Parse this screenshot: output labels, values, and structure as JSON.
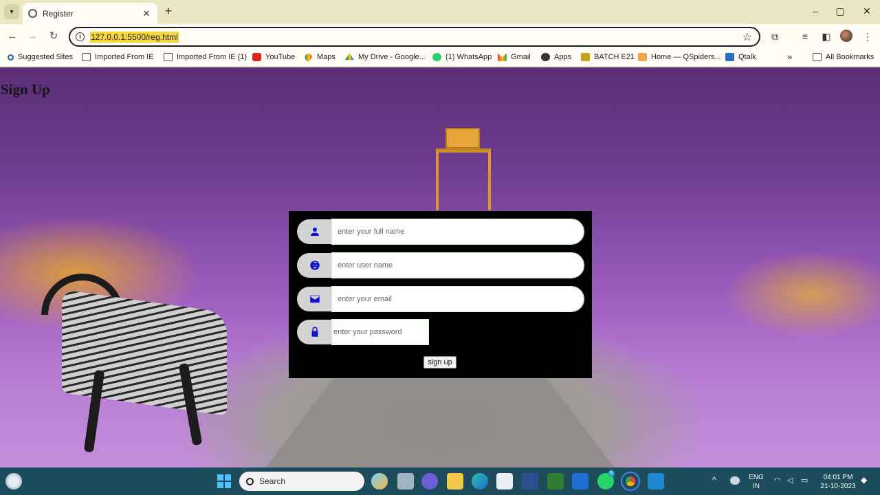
{
  "browser": {
    "tab_title": "Register",
    "url": "127.0.0.1:5500/reg.html",
    "bookmarks": [
      {
        "label": "Suggested Sites",
        "icon": "search-icon"
      },
      {
        "label": "Imported From IE",
        "icon": "folder-icon"
      },
      {
        "label": "Imported From IE (1)",
        "icon": "folder-icon"
      },
      {
        "label": "YouTube",
        "icon": "youtube-icon"
      },
      {
        "label": "Maps",
        "icon": "maps-icon"
      },
      {
        "label": "My Drive - Google...",
        "icon": "drive-icon"
      },
      {
        "label": "(1) WhatsApp",
        "icon": "whatsapp-icon"
      },
      {
        "label": "Gmail",
        "icon": "gmail-icon"
      },
      {
        "label": "Apps",
        "icon": "apps-icon"
      },
      {
        "label": "BATCH E21",
        "icon": "batch-icon"
      },
      {
        "label": "Home — QSpiders...",
        "icon": "qspiders-icon"
      },
      {
        "label": "Qtalk",
        "icon": "qtalk-icon"
      }
    ],
    "all_bookmarks": "All Bookmarks",
    "more_chevron": "»"
  },
  "page": {
    "heading": "Sign Up",
    "form": {
      "fields": [
        {
          "placeholder": "enter your full name",
          "icon": "person-icon"
        },
        {
          "placeholder": "enter user name",
          "icon": "face-icon"
        },
        {
          "placeholder": "enter your email",
          "icon": "mail-icon"
        },
        {
          "placeholder": "enter your password",
          "icon": "lock-icon"
        }
      ],
      "submit_label": "sign up"
    }
  },
  "taskbar": {
    "search_label": "Search",
    "language": "ENG",
    "region": "IN",
    "time": "04:01 PM",
    "date": "21-10-2023",
    "whatsapp_badge": "3"
  },
  "colors": {
    "form_background": "#000000",
    "icon_color": "#1010d0",
    "taskbar": "#1d4d5c",
    "url_highlight": "#f7d63f"
  }
}
